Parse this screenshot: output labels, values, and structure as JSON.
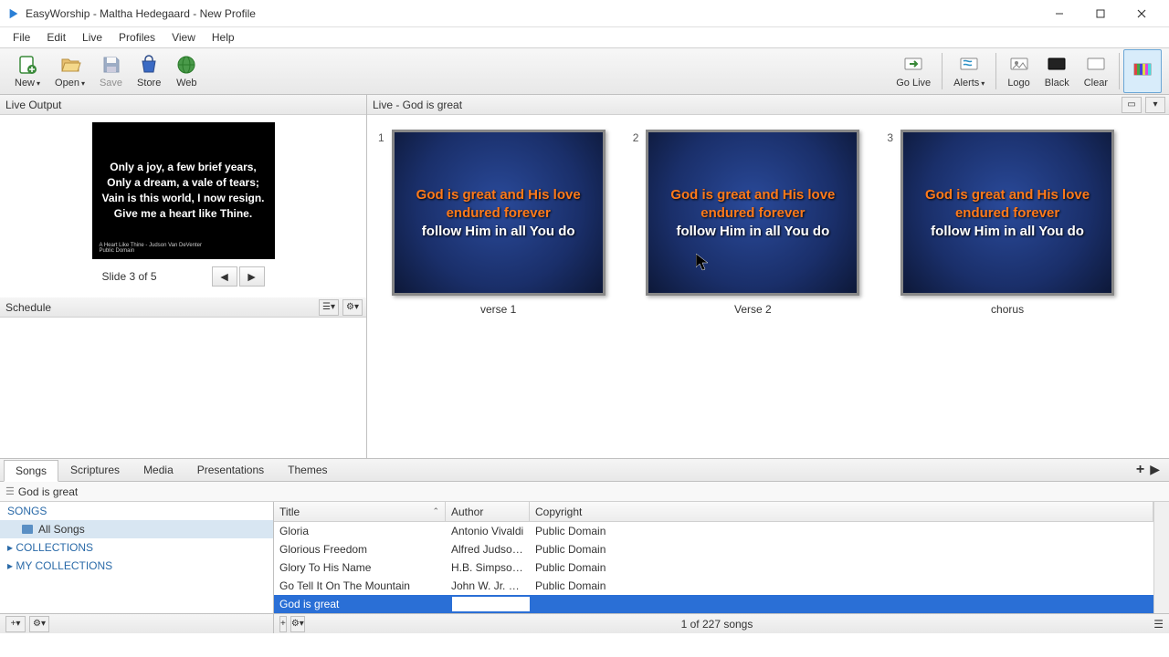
{
  "titlebar": {
    "app": "EasyWorship",
    "profile": "Maltha Hedegaard",
    "suffix": "New Profile"
  },
  "menu": [
    "File",
    "Edit",
    "Live",
    "Profiles",
    "View",
    "Help"
  ],
  "toolbar": {
    "new": "New",
    "open": "Open",
    "save": "Save",
    "store": "Store",
    "web": "Web",
    "golive": "Go Live",
    "alerts": "Alerts",
    "logo": "Logo",
    "black": "Black",
    "clear": "Clear"
  },
  "live_output": {
    "title": "Live Output",
    "slide_text": "Only a joy, a few brief years,\nOnly a dream, a vale of tears;\nVain is this world, I now resign.\nGive me a heart like Thine.",
    "credit": "A Heart Like Thine - Judson Van DeVenter\nPublic Domain",
    "counter": "Slide 3 of 5"
  },
  "schedule": {
    "title": "Schedule"
  },
  "live_panel": {
    "title": "Live - God is great",
    "slides": [
      {
        "num": "1",
        "line1": "God is great and His love\nendured forever",
        "line2": "follow Him in all You do",
        "label": "verse 1"
      },
      {
        "num": "2",
        "line1": "God is great and His love\nendured forever",
        "line2": "follow Him in all You do",
        "label": "Verse 2"
      },
      {
        "num": "3",
        "line1": "God is great and His love\nendured forever",
        "line2": "follow Him in all You do",
        "label": "chorus"
      }
    ]
  },
  "tabs": [
    "Songs",
    "Scriptures",
    "Media",
    "Presentations",
    "Themes"
  ],
  "search": {
    "value": "God is great"
  },
  "tree": {
    "songs": "SONGS",
    "all": "All Songs",
    "collections": "COLLECTIONS",
    "my": "MY COLLECTIONS"
  },
  "table": {
    "headers": {
      "title": "Title",
      "author": "Author",
      "copyright": "Copyright"
    },
    "rows": [
      {
        "title": "Gloria",
        "author": "Antonio Vivaldi",
        "copyright": "Public Domain"
      },
      {
        "title": "Glorious Freedom",
        "author": "Alfred Judson ...",
        "copyright": "Public Domain"
      },
      {
        "title": "Glory To His Name",
        "author": "H.B. Simpson J...",
        "copyright": "Public Domain"
      },
      {
        "title": "Go Tell It On The Mountain",
        "author": "John W. Jr. Work",
        "copyright": "Public Domain"
      },
      {
        "title": "God is great",
        "author": "",
        "copyright": "",
        "selected": true
      }
    ]
  },
  "status": {
    "count": "1 of 227 songs"
  }
}
